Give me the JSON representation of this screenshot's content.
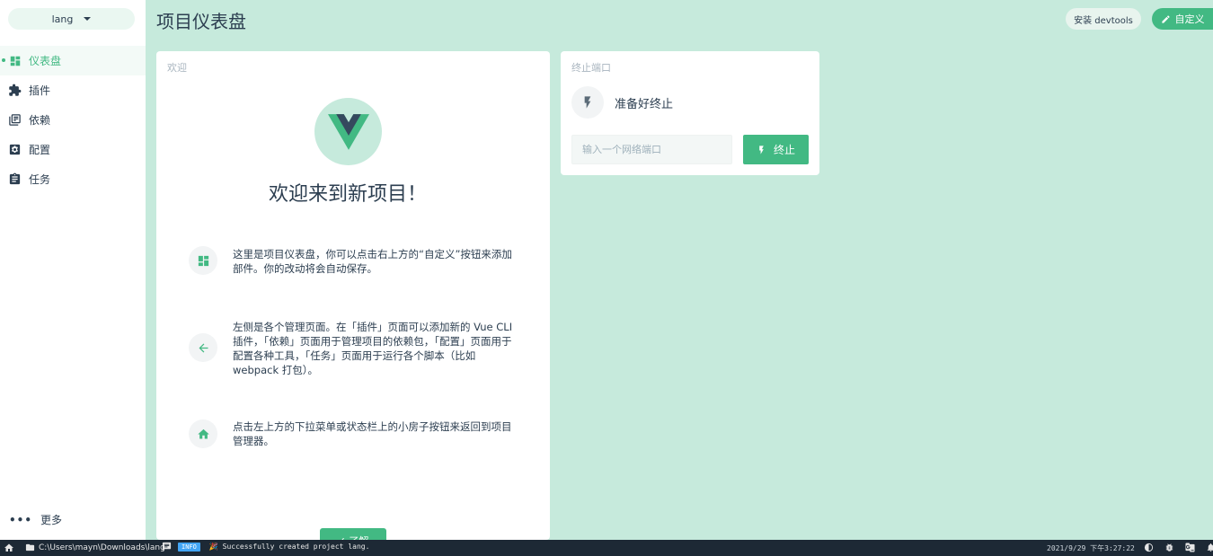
{
  "sidebar": {
    "project_name": "lang",
    "items": [
      {
        "label": "仪表盘",
        "icon": "dashboard-icon",
        "active": true
      },
      {
        "label": "插件",
        "icon": "puzzle-icon"
      },
      {
        "label": "依赖",
        "icon": "library-icon"
      },
      {
        "label": "配置",
        "icon": "settings-icon"
      },
      {
        "label": "任务",
        "icon": "clipboard-icon"
      }
    ],
    "more_label": "更多"
  },
  "header": {
    "title": "项目仪表盘",
    "devtools_label": "安装 devtools",
    "customize_label": "自定义"
  },
  "welcome": {
    "card_title": "欢迎",
    "heading": "欢迎来到新项目！",
    "tips": [
      {
        "icon": "dashboard-icon",
        "text": "这里是项目仪表盘，你可以点击右上方的“自定义”按钮来添加部件。你的改动将会自动保存。"
      },
      {
        "icon": "arrow-left-icon",
        "text": "左侧是各个管理页面。在「插件」页面可以添加新的 Vue CLI 插件，「依赖」页面用于管理项目的依赖包，「配置」页面用于配置各种工具，「任务」页面用于运行各个脚本（比如 webpack 打包）。"
      },
      {
        "icon": "home-icon",
        "text": "点击左上方的下拉菜单或状态栏上的小房子按钮来返回到项目管理器。"
      }
    ],
    "start_label": "✓ 了解"
  },
  "kill_port": {
    "card_title": "终止端口",
    "status": "准备好终止",
    "input_placeholder": "输入一个网络端口",
    "input_value": "",
    "button_label": "终止"
  },
  "statusbar": {
    "path": "C:\\Users\\mayn\\Downloads\\lang",
    "log_level": "INFO",
    "log_message": "🎉  Successfully created project lang.",
    "time": "2021/9/29 下午3:27:22"
  },
  "colors": {
    "accent": "#42b983",
    "background": "#c6eadc",
    "vue_dark": "#35495e",
    "statusbar": "#1d2935"
  }
}
